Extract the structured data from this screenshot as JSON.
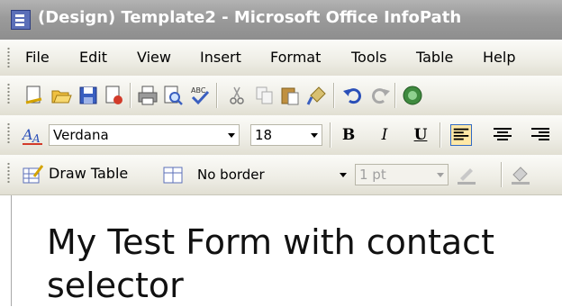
{
  "window": {
    "title": "(Design) Template2 - Microsoft Office InfoPath"
  },
  "menubar": {
    "items": [
      "File",
      "Edit",
      "View",
      "Insert",
      "Format",
      "Tools",
      "Table",
      "Help"
    ]
  },
  "standard_toolbar": {
    "icons": [
      "new-icon",
      "open-icon",
      "save-icon",
      "publish-icon",
      "print-icon",
      "print-preview-icon",
      "spelling-icon",
      "cut-icon",
      "copy-icon",
      "paste-icon",
      "format-painter-icon",
      "undo-icon",
      "redo-icon",
      "help-icon"
    ]
  },
  "format_toolbar": {
    "font_name": "Verdana",
    "font_size": "18",
    "bold": "B",
    "italic": "I",
    "underline": "U",
    "align_left_active": true
  },
  "table_toolbar": {
    "draw_table": "Draw Table",
    "border_style": "No border",
    "border_width": "1 pt"
  },
  "form": {
    "title": "My Test Form with contact selector"
  }
}
